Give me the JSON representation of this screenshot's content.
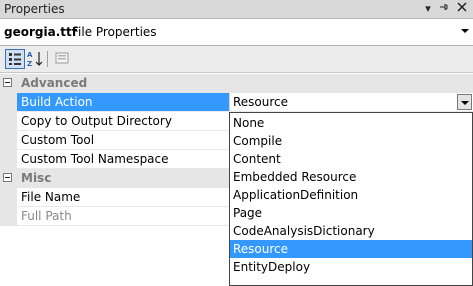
{
  "window": {
    "title": "Properties"
  },
  "object": {
    "name": "georgia.ttf",
    "type": "File Properties"
  },
  "colors": {
    "selection": "#3399ff",
    "category_bg": "#e6e6e6"
  },
  "categories": [
    {
      "label": "Advanced",
      "properties": [
        {
          "name": "Build Action",
          "value": "Resource",
          "selected": true
        },
        {
          "name": "Copy to Output Directory",
          "value": ""
        },
        {
          "name": "Custom Tool",
          "value": ""
        },
        {
          "name": "Custom Tool Namespace",
          "value": ""
        }
      ]
    },
    {
      "label": "Misc",
      "properties": [
        {
          "name": "File Name",
          "value": ""
        },
        {
          "name": "Full Path",
          "value": ""
        }
      ]
    }
  ],
  "dropdown": {
    "options": [
      "None",
      "Compile",
      "Content",
      "Embedded Resource",
      "ApplicationDefinition",
      "Page",
      "CodeAnalysisDictionary",
      "Resource",
      "EntityDeploy"
    ],
    "highlighted": "Resource"
  }
}
